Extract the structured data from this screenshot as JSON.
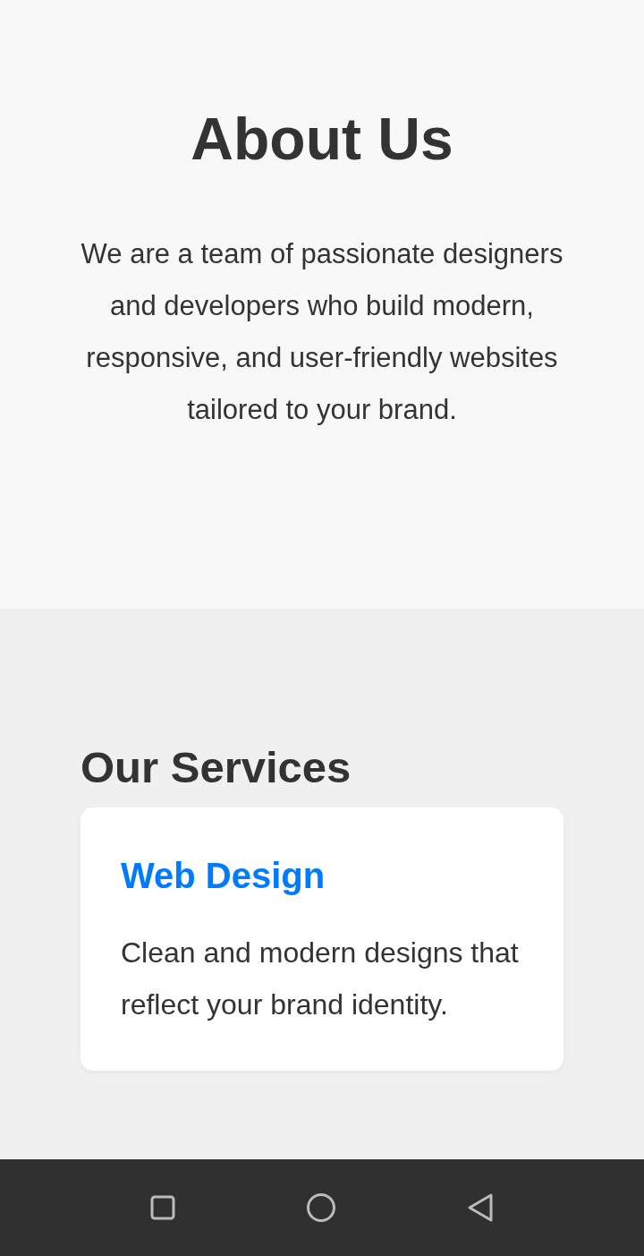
{
  "about": {
    "title": "About Us",
    "text": "We are a team of passionate designers and developers who build modern, responsive, and user-friendly websites tailored to your brand."
  },
  "services": {
    "title": "Our Services",
    "cards": [
      {
        "title": "Web Design",
        "text": "Clean and modern designs that reflect your brand identity."
      }
    ]
  },
  "nav_bar": {
    "buttons": [
      {
        "kind": "recent"
      },
      {
        "kind": "home"
      },
      {
        "kind": "back"
      }
    ]
  }
}
